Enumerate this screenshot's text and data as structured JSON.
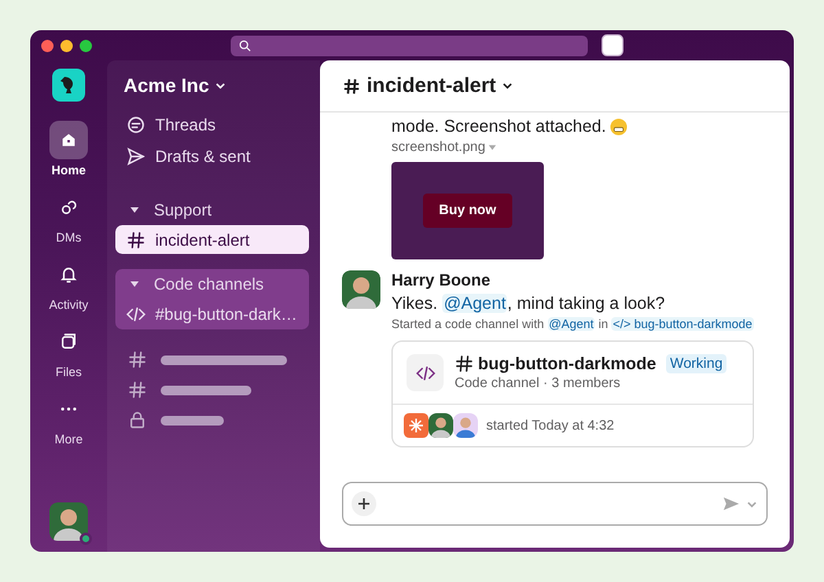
{
  "workspace": {
    "name": "Acme Inc"
  },
  "rail": [
    {
      "kind": "home",
      "label": "Home",
      "selected": true
    },
    {
      "kind": "dms",
      "label": "DMs",
      "selected": false
    },
    {
      "kind": "bell",
      "label": "Activity",
      "selected": false
    },
    {
      "kind": "files",
      "label": "Files",
      "selected": false
    },
    {
      "kind": "more",
      "label": "More",
      "selected": false
    }
  ],
  "user": {
    "online": true
  },
  "sidebar": {
    "shortcuts": [
      {
        "kind": "threads",
        "label": "Threads"
      },
      {
        "kind": "drafts",
        "label": "Drafts & sent"
      }
    ],
    "sections": [
      {
        "title": "Support",
        "expanded": true,
        "highlighted": false,
        "items": [
          {
            "kind": "hash",
            "label": "incident-alert",
            "selected": true
          }
        ]
      },
      {
        "title": "Code channels",
        "expanded": true,
        "highlighted": true,
        "items": [
          {
            "kind": "code",
            "label": "#bug-button-dark…",
            "selected": false
          }
        ]
      }
    ],
    "placeholders": [
      {
        "kind": "hash"
      },
      {
        "kind": "hash"
      },
      {
        "kind": "lock"
      }
    ]
  },
  "channel": {
    "name": "incident-alert"
  },
  "messages": [
    {
      "kind": "continued",
      "text": "mode. Screenshot attached.",
      "emoji": true,
      "attachment": {
        "name": "screenshot.png",
        "button": "Buy now"
      }
    },
    {
      "kind": "full",
      "author": "Harry Boone",
      "segments": [
        {
          "kind": "text",
          "text": "Yikes. "
        },
        {
          "kind": "mention",
          "text": "@Agent"
        },
        {
          "kind": "text",
          "text": ", mind taking a look?"
        }
      ],
      "meta": [
        {
          "kind": "text",
          "text": "Started a code channel with "
        },
        {
          "kind": "mention",
          "text": "@Agent"
        },
        {
          "kind": "text",
          "text": " in "
        },
        {
          "kind": "mention",
          "text": "</> bug-button-darkmode"
        }
      ],
      "card": {
        "title": "bug-button-darkmode",
        "status": "Working",
        "subtitle": "Code channel · 3 members",
        "footer": "started Today at 4:32"
      }
    }
  ]
}
